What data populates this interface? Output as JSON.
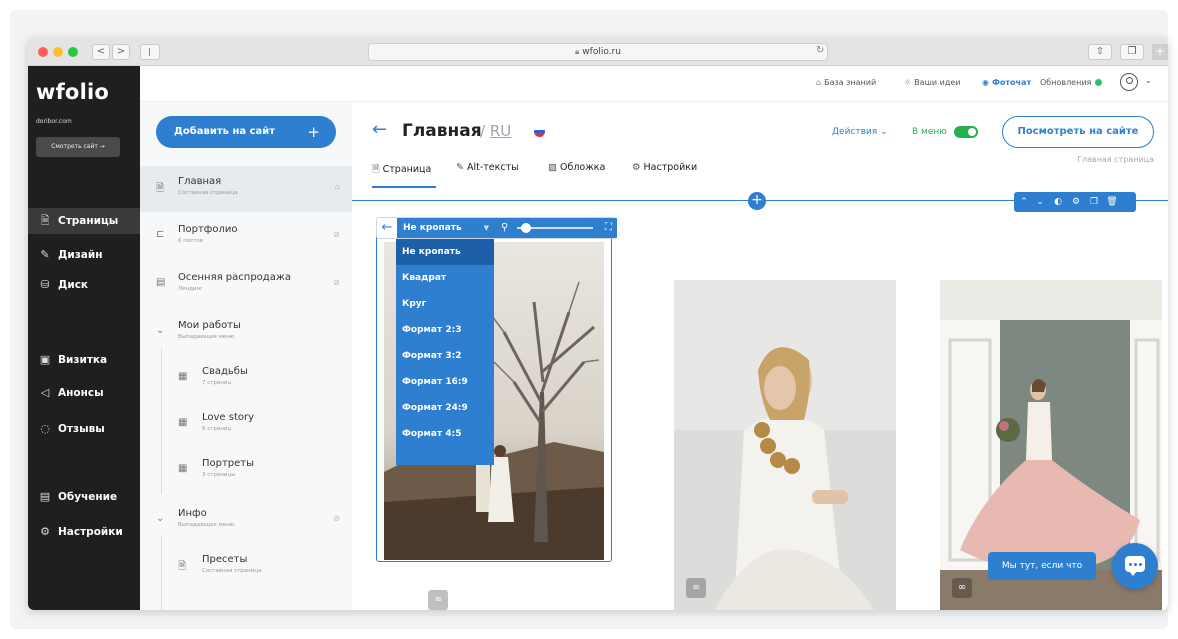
{
  "browser": {
    "url": "wfolio.ru",
    "back": "<",
    "forward": ">"
  },
  "sidebar": {
    "logo": "wfolio",
    "domain": "doribor.com",
    "see_site": "Смотреть сайт →",
    "items": [
      {
        "label": "Страницы",
        "icon": "page-icon",
        "glyph": "🗎"
      },
      {
        "label": "Дизайн",
        "icon": "brush-icon",
        "glyph": "✎"
      },
      {
        "label": "Диск",
        "icon": "disk-icon",
        "glyph": "⛁"
      },
      {
        "label": "Визитка",
        "icon": "card-icon",
        "glyph": "▣"
      },
      {
        "label": "Анонсы",
        "icon": "megaphone-icon",
        "glyph": "◁"
      },
      {
        "label": "Отзывы",
        "icon": "reviews-icon",
        "glyph": "◌"
      },
      {
        "label": "Обучение",
        "icon": "book-icon",
        "glyph": "▤"
      },
      {
        "label": "Настройки",
        "icon": "gear-icon",
        "glyph": "⚙"
      }
    ]
  },
  "topbar": {
    "knowledge": "База знаний",
    "ideas": "Ваши идеи",
    "photochat": "Фоточат",
    "updates": "Обновления"
  },
  "pages_panel": {
    "add_button": "Добавить на сайт",
    "add_plus": "+",
    "pages": [
      {
        "name": "Главная",
        "sub": "Составная страница"
      },
      {
        "name": "Портфолио",
        "sub": "6 постов"
      },
      {
        "name": "Осенняя распродажа",
        "sub": "Лендинг"
      },
      {
        "name": "Мои работы",
        "sub": "Выпадающее меню"
      },
      {
        "name": "Свадьбы",
        "sub": "7 страниц"
      },
      {
        "name": "Love story",
        "sub": "6 страниц"
      },
      {
        "name": "Портреты",
        "sub": "3 страницы"
      },
      {
        "name": "Инфо",
        "sub": "Выпадающее меню"
      },
      {
        "name": "Пресеты",
        "sub": "Составная страница"
      }
    ]
  },
  "main": {
    "title": "Главная",
    "lang_sep": "/",
    "lang_code": "RU",
    "actions": "Действия ⌄",
    "in_menu": "В меню",
    "in_menu_on": true,
    "view_site": "Посмотреть на сайте",
    "home_note": "Главная страница",
    "tabs": [
      {
        "label": "Страница",
        "glyph": "🗎"
      },
      {
        "label": "Alt-тексты",
        "glyph": "✎"
      },
      {
        "label": "Обложка",
        "glyph": "▨"
      },
      {
        "label": "Настройки",
        "glyph": "⚙"
      }
    ],
    "add_block": "+"
  },
  "crop": {
    "selected": "Не кропать",
    "options": [
      "Не кропать",
      "Квадрат",
      "Круг",
      "Формат 2:3",
      "Формат 3:2",
      "Формат 16:9",
      "Формат 24:9",
      "Формат 4:5"
    ],
    "zoom_level": 0.1
  },
  "chat": {
    "label": "Мы тут, если что"
  },
  "colors": {
    "accent": "#2f7fd1",
    "sidebar_bg": "#1f1f1f",
    "success": "#27b14e"
  }
}
